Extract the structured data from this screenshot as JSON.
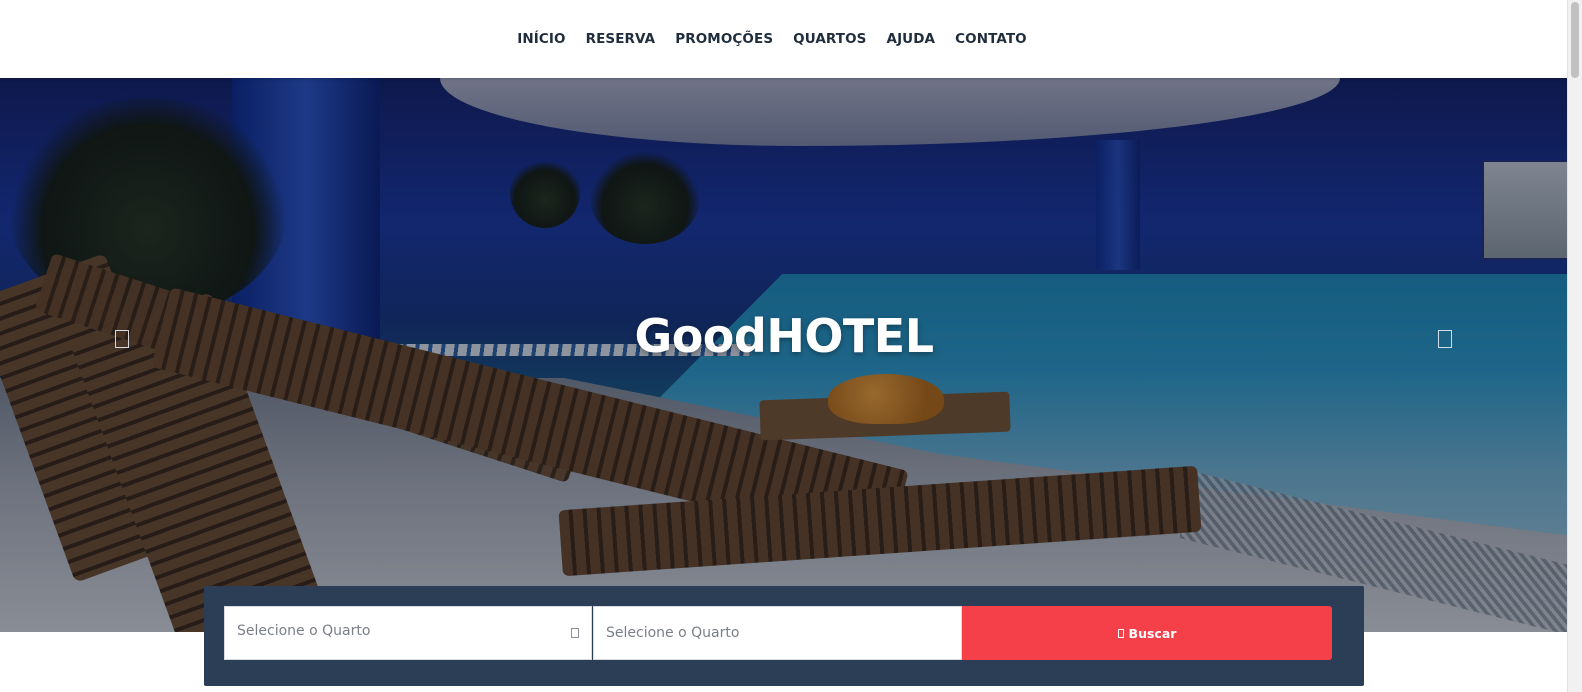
{
  "nav": {
    "items": [
      {
        "label": "INÍCIO"
      },
      {
        "label": "RESERVA"
      },
      {
        "label": "PROMOÇÕES"
      },
      {
        "label": "QUARTOS"
      },
      {
        "label": "AJUDA"
      },
      {
        "label": "CONTATO"
      }
    ]
  },
  "hero": {
    "title": "GoodHOTEL",
    "prev_icon": "chevron-left-icon",
    "next_icon": "chevron-right-icon"
  },
  "search": {
    "room_select_label": "Selecione o Quarto",
    "room_input_placeholder": "Selecione o Quarto",
    "button_label": "Buscar",
    "button_icon": "search-icon"
  },
  "colors": {
    "nav_text": "#1f2d3d",
    "panel_bg": "#2b3e55",
    "button_bg": "#f5404a"
  }
}
